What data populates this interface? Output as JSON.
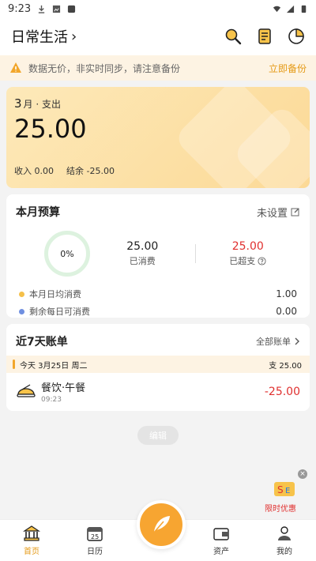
{
  "status": {
    "time": "9:23"
  },
  "header": {
    "title": "日常生活",
    "chevron": "›"
  },
  "notice": {
    "message": "数据无价，非实时同步，请注意备份",
    "action": "立即备份"
  },
  "summary": {
    "month": "3",
    "month_suffix": "月 · 支出",
    "amount": "25.00",
    "income_label": "收入",
    "income": "0.00",
    "balance_label": "结余",
    "balance": "-25.00"
  },
  "budget": {
    "title": "本月预算",
    "set_label": "未设置",
    "percent": "0%",
    "spent": "25.00",
    "spent_label": "已消费",
    "overspent": "25.00",
    "overspent_label": "已超支",
    "stats": [
      {
        "label": "本月日均消费",
        "value": "1.00",
        "color": "#f5c04a"
      },
      {
        "label": "剩余每日可消费",
        "value": "0.00",
        "color": "#6f8fe0"
      }
    ]
  },
  "recent": {
    "title": "近7天账单",
    "all_label": "全部账单",
    "day": {
      "label": "今天 3月25日 周二",
      "summary": "支 25.00"
    },
    "items": [
      {
        "name": "餐饮·午餐",
        "time": "09:23",
        "amount": "-25.00",
        "icon": "food-icon"
      }
    ]
  },
  "edit_label": "编辑",
  "promo": {
    "text": "限时优惠"
  },
  "tabs": [
    {
      "label": "首页",
      "icon": "bank-icon",
      "active": true
    },
    {
      "label": "日历",
      "icon": "calendar-icon",
      "active": false
    },
    {
      "label": "",
      "icon": "feather-icon",
      "active": false
    },
    {
      "label": "资产",
      "icon": "wallet-icon",
      "active": false
    },
    {
      "label": "我的",
      "icon": "person-icon",
      "active": false
    }
  ],
  "colors": {
    "accent": "#e59a16",
    "negative": "#e0302f",
    "fab": "#f7a531"
  }
}
